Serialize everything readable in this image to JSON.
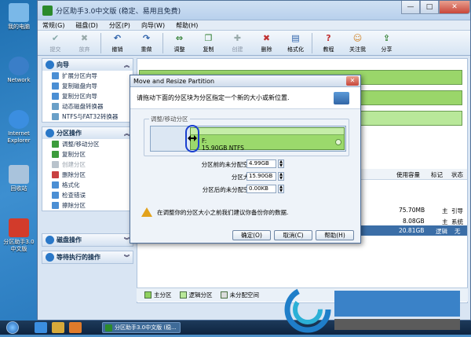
{
  "desktop": {
    "icons": [
      {
        "label": "我的电脑",
        "color": "#7ab8e8"
      },
      {
        "label": "Network",
        "color": "#3a7ec8"
      },
      {
        "label": "Internet Explorer",
        "color": "#3b8ee0"
      },
      {
        "label": "回收站",
        "color": "#a9c3dc"
      },
      {
        "label": "分区助手3.0中文版",
        "color": "#d23b2b"
      }
    ]
  },
  "app": {
    "title": "分区助手3.0中文版 (稳定、易用且免费)",
    "window_buttons": {
      "min": "—",
      "max": "□",
      "close": "✕"
    },
    "menu": [
      "常规(G)",
      "磁盘(D)",
      "分区(P)",
      "向导(W)",
      "帮助(H)"
    ],
    "toolbar": [
      {
        "label": "提交",
        "icon": "check-icon",
        "glyph": "✔",
        "disabled": true
      },
      {
        "label": "放弃",
        "icon": "cancel-icon",
        "glyph": "✖",
        "disabled": true
      },
      {
        "label": "撤销",
        "icon": "undo-icon",
        "glyph": "↶",
        "disabled": false
      },
      {
        "label": "重做",
        "icon": "redo-icon",
        "glyph": "↷",
        "disabled": false
      },
      {
        "label": "调整",
        "icon": "resize-icon",
        "glyph": "⇔",
        "disabled": false
      },
      {
        "label": "复制",
        "icon": "copy-icon",
        "glyph": "❐",
        "disabled": false
      },
      {
        "label": "创建",
        "icon": "create-icon",
        "glyph": "✚",
        "disabled": true
      },
      {
        "label": "删除",
        "icon": "delete-icon",
        "glyph": "✖",
        "disabled": false
      },
      {
        "label": "格式化",
        "icon": "format-icon",
        "glyph": "▤",
        "disabled": false
      },
      {
        "label": "教程",
        "icon": "tutorial-icon",
        "glyph": "?",
        "disabled": false
      },
      {
        "label": "关注我",
        "icon": "follow-icon",
        "glyph": "☺",
        "disabled": false
      },
      {
        "label": "分享",
        "icon": "share-icon",
        "glyph": "⇪",
        "disabled": false
      }
    ],
    "sidebar": {
      "wizard": {
        "title": "向导",
        "items": [
          "扩展分区向导",
          "复制磁盘向导",
          "复制分区向导",
          "动态磁盘转换器",
          "NTFS与FAT32转换器"
        ]
      },
      "partition_ops": {
        "title": "分区操作",
        "items": [
          {
            "label": "调整/移动分区",
            "disabled": false
          },
          {
            "label": "复制分区",
            "disabled": false
          },
          {
            "label": "创建分区",
            "disabled": true
          },
          {
            "label": "删除分区",
            "disabled": false
          },
          {
            "label": "格式化",
            "disabled": false
          },
          {
            "label": "检查错误",
            "disabled": false
          },
          {
            "label": "擦除分区",
            "disabled": false
          }
        ]
      },
      "disk_ops": {
        "title": "磁盘操作"
      },
      "pending_ops": {
        "title": "等待执行的操作"
      }
    },
    "table": {
      "headers": [
        "使用容量",
        "标记",
        "状态"
      ],
      "rows": [
        {
          "used": "75.70MB",
          "flag": "主",
          "status": "引导"
        },
        {
          "used": "8.08GB",
          "flag": "主",
          "status": "系统"
        },
        {
          "used": "20.81GB",
          "flag": "逻辑",
          "status": "无"
        }
      ]
    },
    "legend": [
      {
        "label": "主分区",
        "color": "#8fd15f"
      },
      {
        "label": "逻辑分区",
        "color": "#b9e89a"
      },
      {
        "label": "未分配空间",
        "color": "#dcdcdc"
      }
    ]
  },
  "dialog": {
    "title": "Move and Resize Partition",
    "close": "✕",
    "header_text": "请拖动下面的分区块为分区指定一个新的大小或新位置.",
    "group_label": "调整/移动分区",
    "partition": {
      "letter": "F:",
      "info": "15.90GB NTFS"
    },
    "fields": [
      {
        "label": "分区前的未分配空间(U):",
        "value": "4.99GB"
      },
      {
        "label": "分区大小(S):",
        "value": "15.90GB"
      },
      {
        "label": "分区后的未分配空间(F):",
        "value": "0.00KB"
      }
    ],
    "warning": "在调整你的分区大小之前我们建议你备份你的数据.",
    "buttons": {
      "ok": "确定(O)",
      "cancel": "取消(C)",
      "help": "帮助(H)"
    }
  },
  "taskbar": {
    "task_label": "分区助手3.0中文版 (稳..."
  }
}
